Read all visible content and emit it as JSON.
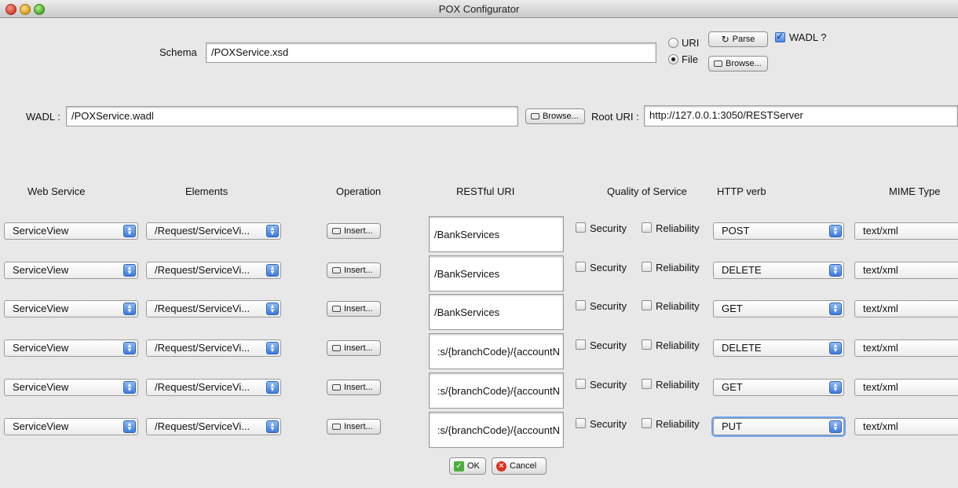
{
  "window": {
    "title": "POX Configurator"
  },
  "schema": {
    "label": "Schema",
    "value": "/POXService.xsd"
  },
  "source": {
    "uri_label": "URI",
    "file_label": "File",
    "selected": "File",
    "parse_label": "Parse",
    "browse_label": "Browse...",
    "wadl_check_label": "WADL ?",
    "wadl_checked": true
  },
  "wadl": {
    "label": "WADL :",
    "value": "/POXService.wadl",
    "browse_label": "Browse..."
  },
  "root_uri": {
    "label": "Root URI :",
    "value": "http://127.0.0.1:3050/RESTServer"
  },
  "columns": [
    "Web Service",
    "Elements",
    "Operation",
    "RESTful URI",
    "Quality of Service",
    "HTTP verb",
    "MIME Type"
  ],
  "rows": [
    {
      "service": "ServiceView",
      "element": "/Request/ServiceVi...",
      "insert": "Insert...",
      "uri": "/BankServices",
      "security": "Security",
      "reliability": "Reliability",
      "verb": "POST",
      "mime": "text/xml"
    },
    {
      "service": "ServiceView",
      "element": "/Request/ServiceVi...",
      "insert": "Insert...",
      "uri": "/BankServices",
      "security": "Security",
      "reliability": "Reliability",
      "verb": "DELETE",
      "mime": "text/xml"
    },
    {
      "service": "ServiceView",
      "element": "/Request/ServiceVi...",
      "insert": "Insert...",
      "uri": "/BankServices",
      "security": "Security",
      "reliability": "Reliability",
      "verb": "GET",
      "mime": "text/xml"
    },
    {
      "service": "ServiceView",
      "element": "/Request/ServiceVi...",
      "insert": "Insert...",
      "uri": ":s/{branchCode}/{accountN",
      "security": "Security",
      "reliability": "Reliability",
      "verb": "DELETE",
      "mime": "text/xml"
    },
    {
      "service": "ServiceView",
      "element": "/Request/ServiceVi...",
      "insert": "Insert...",
      "uri": ":s/{branchCode}/{accountN",
      "security": "Security",
      "reliability": "Reliability",
      "verb": "GET",
      "mime": "text/xml"
    },
    {
      "service": "ServiceView",
      "element": "/Request/ServiceVi...",
      "insert": "Insert...",
      "uri": ":s/{branchCode}/{accountN",
      "security": "Security",
      "reliability": "Reliability",
      "verb": "PUT",
      "mime": "text/xml"
    }
  ],
  "footer": {
    "ok_label": "OK",
    "cancel_label": "Cancel"
  }
}
